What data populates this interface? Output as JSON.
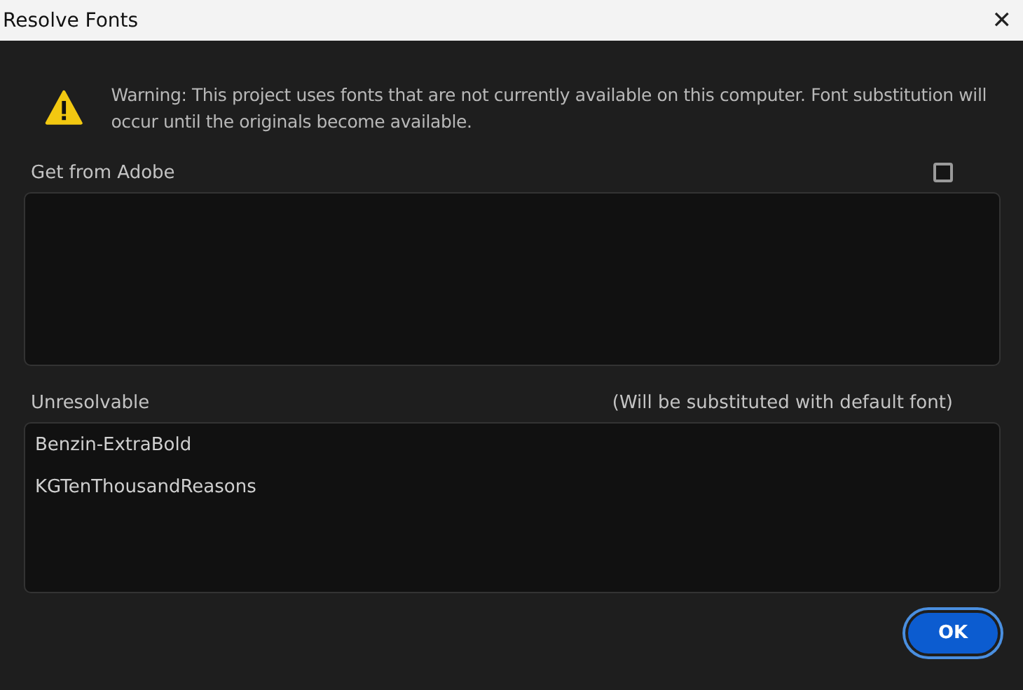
{
  "window": {
    "title": "Resolve Fonts",
    "close": "✕"
  },
  "warning": "Warning: This project uses fonts that are not currently available on this computer. Font substitution will occur until the originals become available.",
  "get_from_adobe": {
    "label": "Get from Adobe",
    "checked": false
  },
  "unresolvable": {
    "label": "Unresolvable",
    "note": "(Will be substituted with default font)",
    "fonts": [
      "Benzin-ExtraBold",
      "KGTenThousandReasons"
    ]
  },
  "buttons": [
    {
      "label": "OK",
      "selected": true
    }
  ]
}
